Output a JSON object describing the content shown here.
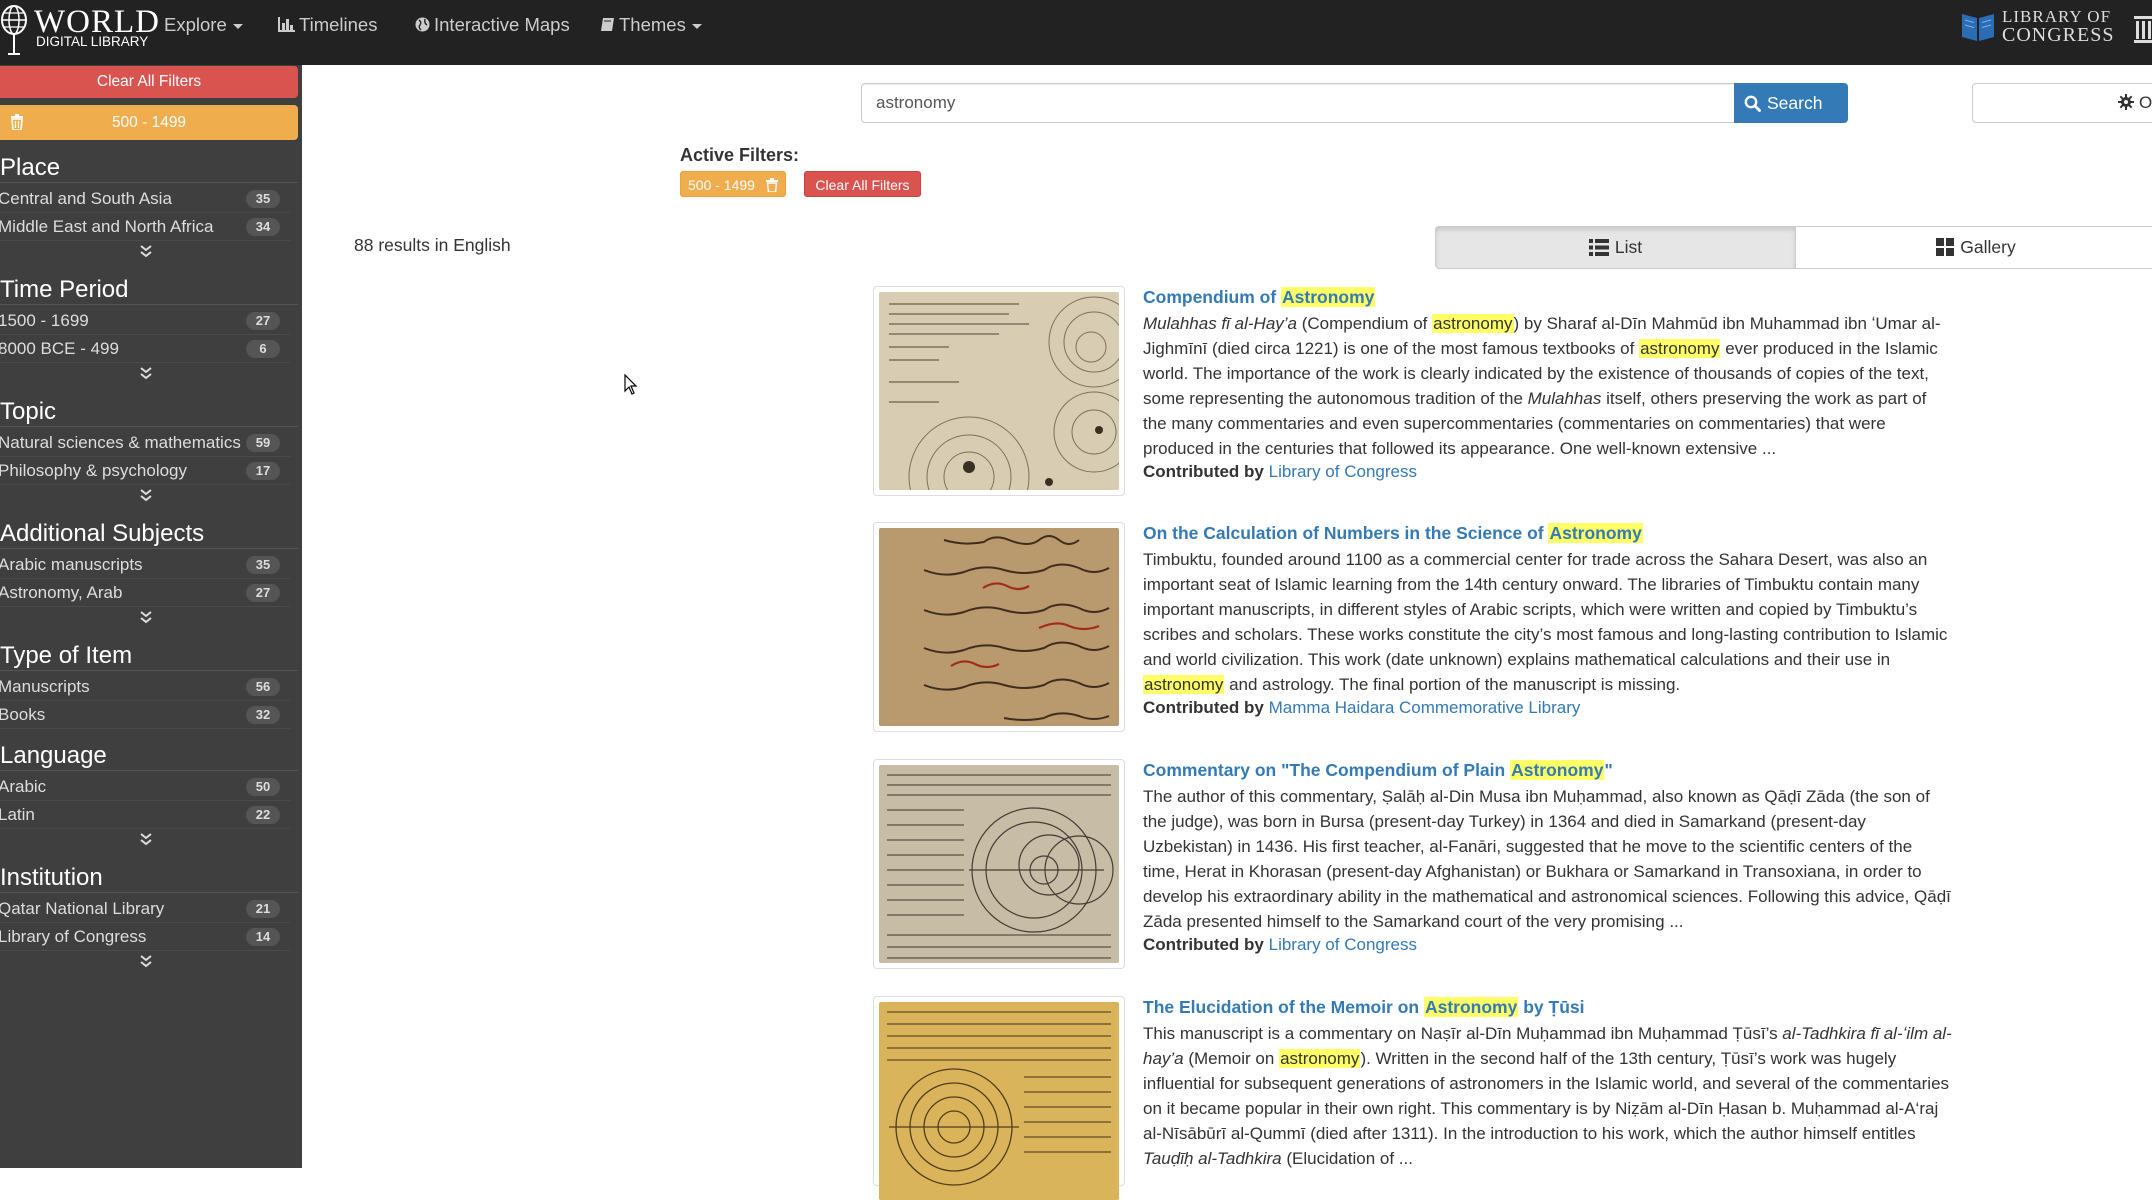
{
  "navbar": {
    "logo_line1": "WORLD",
    "logo_line2": "DIGITAL LIBRARY",
    "items": [
      {
        "label": "Explore",
        "icon": "none",
        "dropdown": true
      },
      {
        "label": "Timelines",
        "icon": "bar-chart-icon",
        "dropdown": false
      },
      {
        "label": "Interactive Maps",
        "icon": "globe-icon",
        "dropdown": false
      },
      {
        "label": "Themes",
        "icon": "book-icon",
        "dropdown": true
      }
    ],
    "partner_line1": "LIBRARY OF",
    "partner_line2": "CONGRESS"
  },
  "sidebar": {
    "clear_all": "Clear All Filters",
    "active_chip": "500 - 1499",
    "facets": [
      {
        "title": "Place",
        "items": [
          {
            "label": "Central and South Asia",
            "count": "35"
          },
          {
            "label": "Middle East and North Africa",
            "count": "34"
          }
        ]
      },
      {
        "title": "Time Period",
        "items": [
          {
            "label": "1500 - 1699",
            "count": "27"
          },
          {
            "label": "8000 BCE - 499",
            "count": "6"
          }
        ]
      },
      {
        "title": "Topic",
        "items": [
          {
            "label": "Natural sciences & mathematics",
            "count": "59"
          },
          {
            "label": "Philosophy & psychology",
            "count": "17"
          }
        ]
      },
      {
        "title": "Additional Subjects",
        "items": [
          {
            "label": "Arabic manuscripts",
            "count": "35"
          },
          {
            "label": "Astronomy, Arab",
            "count": "27"
          }
        ]
      },
      {
        "title": "Type of Item",
        "items": [
          {
            "label": "Manuscripts",
            "count": "56"
          },
          {
            "label": "Books",
            "count": "32"
          }
        ]
      },
      {
        "title": "Language",
        "items": [
          {
            "label": "Arabic",
            "count": "50"
          },
          {
            "label": "Latin",
            "count": "22"
          }
        ]
      },
      {
        "title": "Institution",
        "items": [
          {
            "label": "Qatar National Library",
            "count": "21"
          },
          {
            "label": "Library of Congress",
            "count": "14"
          }
        ]
      }
    ]
  },
  "search": {
    "query": "astronomy",
    "button": "Search",
    "options_label": "O"
  },
  "filters": {
    "label": "Active Filters:",
    "chip": "500 - 1499",
    "clear_all": "Clear All Filters"
  },
  "results": {
    "count_text": "88 results in English",
    "view_list": "List",
    "view_gallery": "Gallery",
    "contributed_by": "Contributed by",
    "items": [
      {
        "title_pre": "Compendium of ",
        "title_hl": "Astronomy",
        "title_post": "",
        "body_html": "<i>Mulahhas fī al-Hay’a</i> (Compendium of <span class=\"hl\">astronomy</span>) by Sharaf al-Dīn Mahmūd ibn Muhammad ibn ʻUmar al-Jighmīnī (died circa 1221) is one of the most famous textbooks of <span class=\"hl\">astronomy</span> ever produced in the Islamic world. The importance of the work is clearly indicated by the existence of thousands of copies of the text, some representing the autonomous tradition of the <i>Mulahhas</i> itself, others preserving the work as part of the many commentaries and even supercommentaries (commentaries on commentaries) that were produced in the centuries that followed its appearance. One well-known extensive ...",
        "contributor": "Library of Congress"
      },
      {
        "title_pre": "On the Calculation of Numbers in the Science of ",
        "title_hl": "Astronomy",
        "title_post": "",
        "body_html": "Timbuktu, founded around 1100 as a commercial center for trade across the Sahara Desert, was also an important seat of Islamic learning from the 14th century onward. The libraries of Timbuktu contain many important manuscripts, in different styles of Arabic scripts, which were written and copied by Timbuktu’s scribes and scholars. These works constitute the city’s most famous and long-lasting contribution to Islamic and world civilization. This work (date unknown) explains mathematical calculations and their use in <span class=\"hl\">astronomy</span> and astrology. The final portion of the manuscript is missing.",
        "contributor": "Mamma Haidara Commemorative Library"
      },
      {
        "title_pre": "Commentary on \"The Compendium of Plain ",
        "title_hl": "Astronomy",
        "title_post": "\"",
        "body_html": "The author of this commentary, Ṣalāḥ al-Din Musa ibn Muḥammad, also known as Qāḍī Zāda (the son of the judge), was born in Bursa (present-day Turkey) in 1364 and died in Samarkand (present-day Uzbekistan) in 1436. His first teacher, al-Fanāri, suggested that he move to the scientific centers of the time, Herat in Khorasan (present-day Afghanistan) or Bukhara or Samarkand in Transoxiana, in order to develop his extraordinary ability in the mathematical and astronomical sciences. Following this advice, Qāḍī Zāda presented himself to the Samarkand court of the very promising ...",
        "contributor": "Library of Congress"
      },
      {
        "title_pre": "The Elucidation of the Memoir on ",
        "title_hl": "Astronomy",
        "title_post": " by Ṭūsi",
        "body_html": "This manuscript is a commentary on Naṣīr al-Dīn Muḥammad ibn Muḥammad Ṭūsī’s <i>al-Tadhkira fī al-ʻilm al-hay’a</i> (Memoir on <span class=\"hl\">astronomy</span>). Written in the second half of the 13th century, Ṭūsī’s work was hugely influential for subsequent generations of astronomers in the Islamic world, and several of the commentaries on it became popular in their own right. This commentary is by Niẓām al-Dīn Ḥasan b. Muḥammad al-A‘raj al-Nīsābūrī al-Qummī (died after 1311). In the introduction to his work, which the author himself entitles <i>Tauḍīḥ al-Tadhkira</i> (Elucidation of ...",
        "contributor": ""
      }
    ]
  },
  "colors": {
    "navbar_bg": "#222222",
    "sidebar_bg": "#3f3f3f",
    "danger": "#d9534f",
    "warning": "#f0ad4e",
    "primary": "#337ab7",
    "highlight": "#ffff66"
  }
}
